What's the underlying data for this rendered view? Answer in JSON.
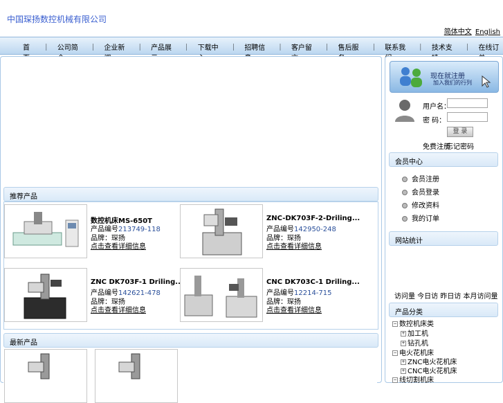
{
  "header": {
    "company_name": "中国琛扬数控机械有限公司",
    "link_chinese": "简体中文",
    "link_english": "English"
  },
  "nav": {
    "items": [
      "首页",
      "公司简介",
      "企业新闻",
      "产品展示",
      "下载中心",
      "招聘信息",
      "客户留言",
      "售后服务",
      "联系我们",
      "技术支持",
      "在线订单"
    ],
    "separator": "｜"
  },
  "featured": {
    "title": "推荐产品",
    "products": [
      {
        "name": "数控机床MS-650T",
        "code_label": "产品编号",
        "code": "213749-118",
        "brand_label": "品牌：琛扬",
        "more": "点击查看详细信息"
      },
      {
        "name": "ZNC-DK703F-2-Driling...",
        "code_label": "产品编号",
        "code": "142950-248",
        "brand_label": "品牌：琛扬",
        "more": "点击查看详细信息"
      },
      {
        "name": "ZNC DK703F-1 Driling...",
        "code_label": "产品编号",
        "code": "142621-478",
        "brand_label": "品牌：琛扬",
        "more": "点击查看详细信息"
      },
      {
        "name": "CNC DK703C-1 Driling...",
        "code_label": "产品编号",
        "code": "12214-715",
        "brand_label": "品牌：琛扬",
        "more": "点击查看详细信息"
      }
    ]
  },
  "latest": {
    "title": "最新产品"
  },
  "sidebar": {
    "banner_title": "现在就注册",
    "banner_subtitle": "加入我们的行列",
    "username_label": "用户名：",
    "password_label": "密 码：",
    "login_button": "登 录",
    "register_link": "免费注册",
    "forgot_link": "忘记密码",
    "member_title": "会员中心",
    "member_items": [
      "会员注册",
      "会员登录",
      "修改资料",
      "我的订单"
    ],
    "stats_title": "网站统计",
    "stats_line": "访问量 今日访 昨日访 本月访问量",
    "category_title": "产品分类",
    "tree": [
      {
        "label": "数控机床类",
        "level": 0
      },
      {
        "label": "加工机",
        "level": 1
      },
      {
        "label": "钻孔机",
        "level": 1
      },
      {
        "label": "电火花机床",
        "level": 0
      },
      {
        "label": "ZNC电火花机床",
        "level": 1
      },
      {
        "label": "CNC电火花机床",
        "level": 1
      },
      {
        "label": "线切割机床",
        "level": 0
      }
    ]
  }
}
